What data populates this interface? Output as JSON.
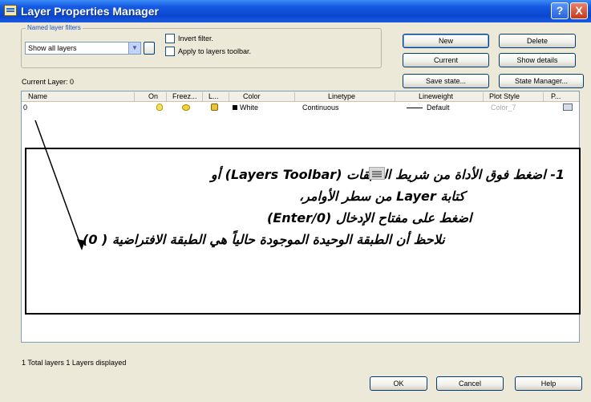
{
  "window": {
    "title": "Layer Properties Manager",
    "help_label": "?",
    "close_label": "X"
  },
  "filters": {
    "legend": "Named layer filters",
    "select_value": "Show all layers",
    "invert_label": "Invert filter.",
    "apply_label": "Apply to layers toolbar."
  },
  "buttons": {
    "new": "New",
    "delete": "Delete",
    "current": "Current",
    "show_details": "Show details",
    "save_state": "Save state...",
    "state_manager": "State Manager...",
    "ok": "OK",
    "cancel": "Cancel",
    "help": "Help"
  },
  "current_layer": "Current Layer:  0",
  "columns": [
    "Name",
    "On",
    "Freez...",
    "L...",
    "Color",
    "Linetype",
    "Lineweight",
    "Plot Style",
    "P..."
  ],
  "rows": [
    {
      "name": "0",
      "color": "White",
      "linetype": "Continuous",
      "lineweight": "Default",
      "plot_style": "Color_7"
    }
  ],
  "annotation": {
    "line1": "1- اضغط فوق الأداة          من شريط الطبقات (Layers Toolbar) أو",
    "line2": "كتابة  Layer من سطر الأوامر،",
    "line3": "اضغط على مفتاح الإدخال (Enter/0)",
    "line4": "نلاحظ أن الطبقة الوحيدة الموجودة حالياً هي الطبقة الافتراضية ( 0)"
  },
  "status": "1 Total layers    1 Layers displayed",
  "icons": {
    "app": "layer-manager-icon",
    "on": "lightbulb-icon",
    "freeze": "sun-icon",
    "lock": "padlock-icon",
    "plot": "printer-icon"
  }
}
